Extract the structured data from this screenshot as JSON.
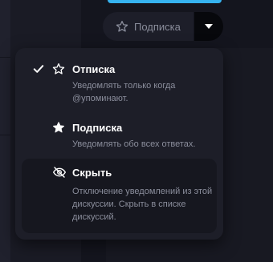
{
  "subscription_button": {
    "label": "Подписка",
    "icon": "star-outline-icon"
  },
  "dropdown_toggle": {
    "icon": "caret-down-icon"
  },
  "menu": {
    "items": [
      {
        "title": "Отписка",
        "description": "Уведомлять только когда @упоминают.",
        "icon": "star-outline-icon",
        "checked": true
      },
      {
        "title": "Подписка",
        "description": "Уведомлять обо всех ответах.",
        "icon": "star-filled-icon",
        "checked": false
      },
      {
        "title": "Скрыть",
        "description": "Отключение уведомлений из этой дискуссии. Скрыть в списке дискуссий.",
        "icon": "eye-slash-icon",
        "checked": false
      }
    ]
  },
  "colors": {
    "background": "#14151e",
    "menu_bg": "#1d1e28",
    "selected_item_bg": "#16171f",
    "accent": "#36b3f0",
    "title_text": "#ffffff",
    "desc_text": "#8b8e9c"
  }
}
